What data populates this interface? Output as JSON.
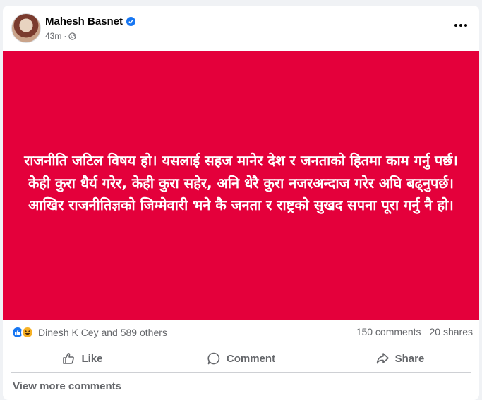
{
  "post": {
    "author": "Mahesh Basnet",
    "time": "43m",
    "separator": "·",
    "image_text": "राजनीति जटिल विषय हो। यसलाई सहज मानेर देश र जनताको हितमा काम गर्नु पर्छ। केही कुरा धैर्य गरेर, केही कुरा सहेर, अनि धेरै कुरा नजरअन्दाज गरेर अघि बढ्नुपर्छ। आखिर राजनीतिज्ञको जिम्मेवारी भने कै जनता र राष्ट्रको सुखद सपना पूरा गर्नु नै हो।",
    "image_bg_color": "#e4003b"
  },
  "stats": {
    "reaction_names": "Dinesh K Cey and 589 others",
    "comments": "150 comments",
    "shares": "20 shares"
  },
  "actions": {
    "like": "Like",
    "comment": "Comment",
    "share": "Share"
  },
  "footer": {
    "view_more": "View more comments"
  },
  "icons": [
    "verified-icon",
    "globe-icon",
    "more-icon",
    "like-reaction-icon",
    "haha-reaction-icon",
    "thumbs-up-icon",
    "comment-icon",
    "share-icon"
  ]
}
